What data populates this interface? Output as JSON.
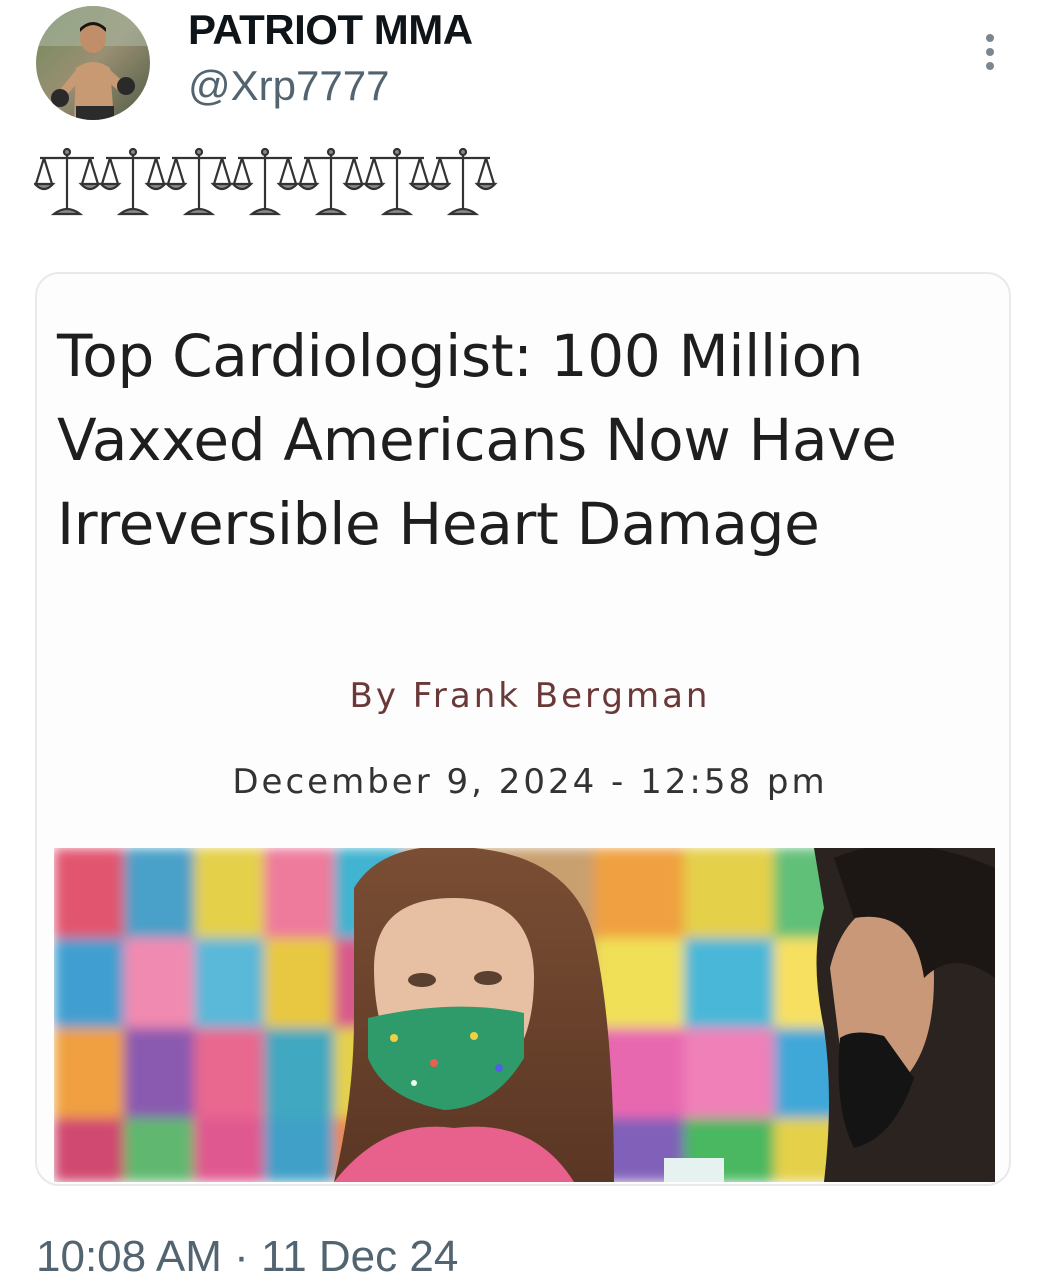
{
  "author": {
    "display_name": "PATRIOT MMA",
    "handle": "@Xrp7777",
    "avatar_icon": "fighter-avatar-icon"
  },
  "menu": {
    "more_icon": "more-vertical-icon"
  },
  "tweet": {
    "text": "⚖️⚖️⚖️⚖️⚖️⚖️⚖️⚖️⚖️⚖️⚖️⚖️⚖️⚖️",
    "scales_icon": "balance-scale-icon",
    "scales_count": 7
  },
  "card": {
    "headline": "Top Cardiologist: 100 Million Vaxxed Americans Now Have Irreversible Heart Damage",
    "byline": "By Frank Bergman",
    "dateline": "December 9, 2024 - 12:58 pm",
    "image_icon": "article-photo-masked-child"
  },
  "meta": {
    "timestamp": "10:08 AM · 11 Dec 24"
  },
  "colors": {
    "text_primary": "#0f1419",
    "text_secondary": "#536471",
    "byline": "#6b3838",
    "card_border": "#e7eaec"
  }
}
